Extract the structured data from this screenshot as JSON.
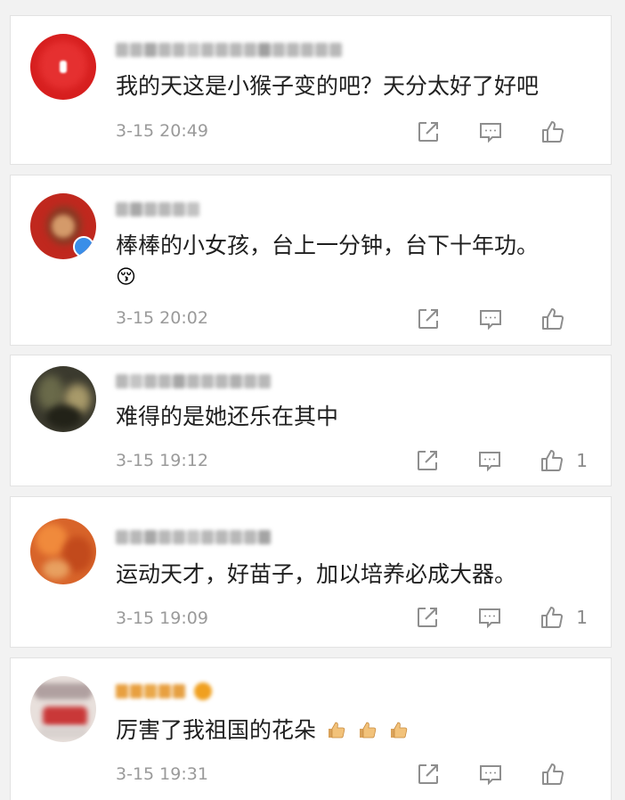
{
  "comments": [
    {
      "text": "我的天这是小猴子变的吧？天分太好了好吧",
      "extra_emoji": "",
      "time": "3-15 20:49",
      "likes": "",
      "avatar_color": "#d71f1f"
    },
    {
      "text": "棒棒的小女孩，台上一分钟，台下十年功。",
      "extra_emoji": "😚",
      "time": "3-15 20:02",
      "likes": "",
      "avatar_color": "#c0281e"
    },
    {
      "text": "难得的是她还乐在其中",
      "extra_emoji": "",
      "time": "3-15 19:12",
      "likes": "1",
      "avatar_color": "#3b3a2e"
    },
    {
      "text": "运动天才，好苗子，加以培养必成大器。",
      "extra_emoji": "",
      "time": "3-15 19:09",
      "likes": "1",
      "avatar_color": "#d8642a"
    },
    {
      "text": "厉害了我祖国的花朵",
      "extra_emoji": "",
      "time": "3-15 19:31",
      "likes": "",
      "avatar_color": "#c93838"
    }
  ],
  "icons": {
    "share": "share-icon",
    "comment": "comment-icon",
    "like": "thumbs-up-icon"
  }
}
